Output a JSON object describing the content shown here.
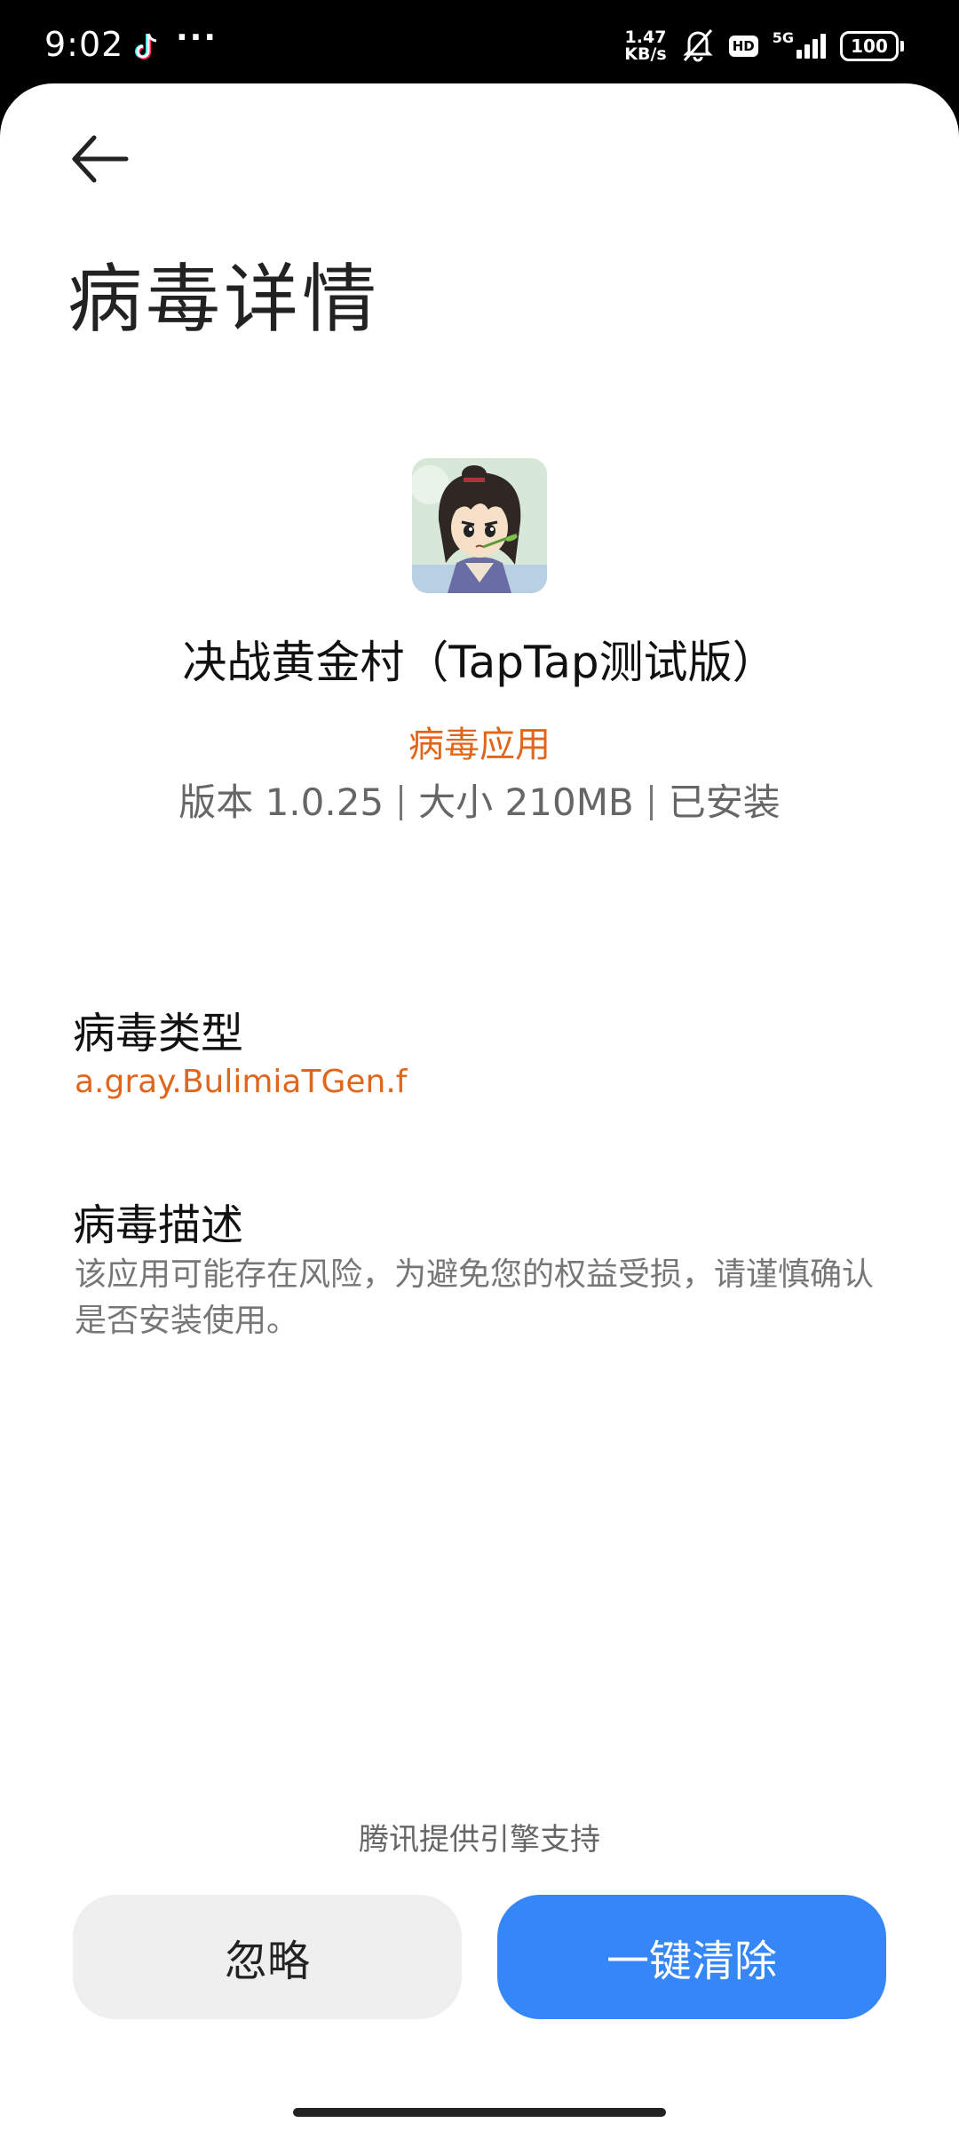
{
  "status_bar": {
    "time": "9:02",
    "overflow": "···",
    "net_speed_value": "1.47",
    "net_speed_unit": "KB/s",
    "hd": "HD",
    "network": "5G",
    "battery": "100",
    "icons": [
      "tiktok-icon",
      "bell-muted-icon",
      "signal-icon",
      "battery-icon"
    ]
  },
  "header": {
    "back_icon": "arrow-left-icon",
    "title": "病毒详情"
  },
  "app": {
    "icon": "app-icon-character",
    "name": "决战黄金村（TapTap测试版）",
    "threat_tag": "病毒应用",
    "version": "版本 1.0.25",
    "size": "大小 210MB",
    "status": "已安装"
  },
  "virus_type": {
    "label": "病毒类型",
    "value": "a.gray.BulimiaTGen.f"
  },
  "virus_desc": {
    "label": "病毒描述",
    "value": "该应用可能存在风险，为避免您的权益受损，请谨慎确认是否安装使用。"
  },
  "footer": {
    "provider": "腾讯提供引擎支持",
    "ignore_label": "忽略",
    "clean_label": "一键清除"
  },
  "colors": {
    "accent": "#3587f7",
    "warning": "#e0661d"
  }
}
